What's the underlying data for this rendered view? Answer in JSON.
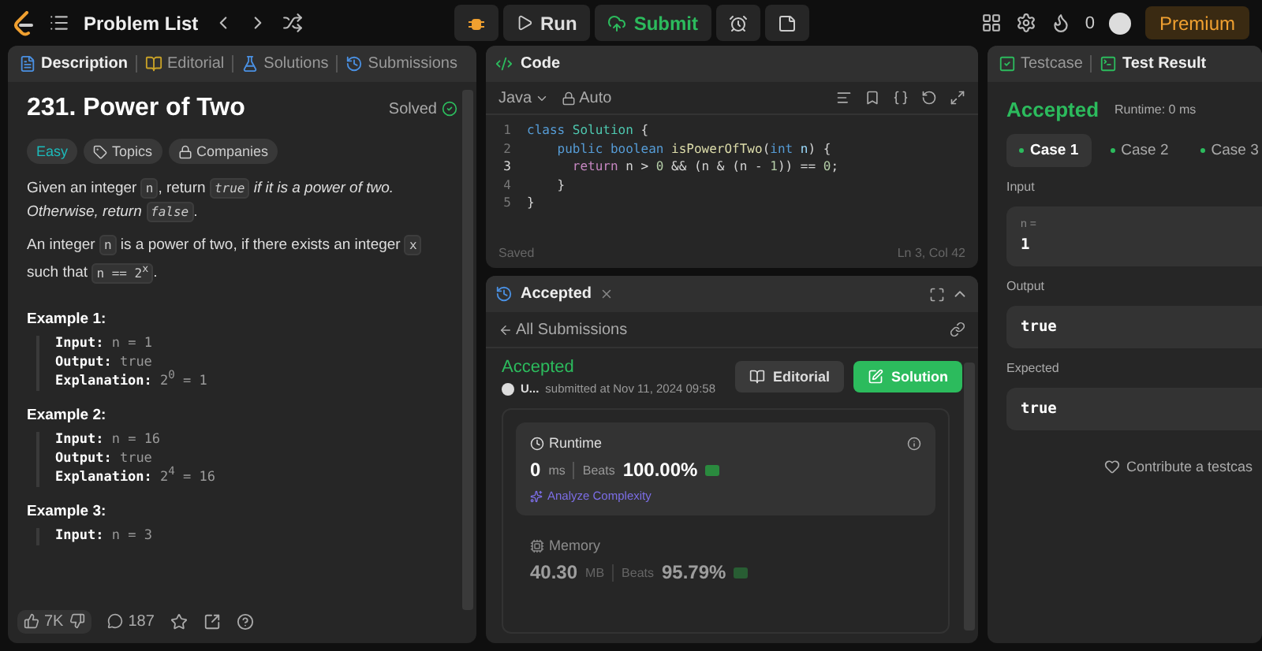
{
  "topbar": {
    "nav_title": "Problem List",
    "run": "Run",
    "submit": "Submit",
    "streak": "0",
    "premium": "Premium"
  },
  "description_panel": {
    "tabs": [
      {
        "label": "Description",
        "selected": true,
        "kind": "description"
      },
      {
        "label": "Editorial",
        "selected": false,
        "kind": "editorial"
      },
      {
        "label": "Solutions",
        "selected": false,
        "kind": "solutions"
      },
      {
        "label": "Submissions",
        "selected": false,
        "kind": "submissions"
      }
    ],
    "title": "231. Power of Two",
    "status": "Solved",
    "tags": [
      {
        "label": "Easy",
        "kind": "difficulty"
      },
      {
        "label": "Topics",
        "kind": "topics"
      },
      {
        "label": "Companies",
        "kind": "companies"
      }
    ],
    "paragraphs": [
      [
        {
          "kind": "plain",
          "text": "Given an integer "
        },
        {
          "kind": "code",
          "text": "n"
        },
        {
          "kind": "plain",
          "text": ", return "
        },
        {
          "kind": "code_italic",
          "text": "true"
        },
        {
          "kind": "italic",
          "text": " if it is a power of two. Otherwise, return "
        },
        {
          "kind": "code_italic",
          "text": "false"
        },
        {
          "kind": "plain",
          "text": "."
        }
      ],
      [
        {
          "kind": "plain",
          "text": "An integer "
        },
        {
          "kind": "code",
          "text": "n"
        },
        {
          "kind": "plain",
          "text": " is a power of two, if there exists an integer "
        },
        {
          "kind": "code",
          "text": "x"
        },
        {
          "kind": "plain",
          "text": " such that "
        },
        {
          "kind": "code",
          "text": "n == 2$^{x}$"
        },
        {
          "kind": "plain",
          "text": "."
        }
      ]
    ],
    "examples": [
      {
        "title": "Example 1:",
        "lines": [
          {
            "label": "Input:",
            "value": "n = 1"
          },
          {
            "label": "Output:",
            "value": "true"
          },
          {
            "label": "Explanation:",
            "value": "2$^{0}$ = 1"
          }
        ]
      },
      {
        "title": "Example 2:",
        "lines": [
          {
            "label": "Input:",
            "value": "n = 16"
          },
          {
            "label": "Output:",
            "value": "true"
          },
          {
            "label": "Explanation:",
            "value": "2$^{4}$ = 16"
          }
        ]
      },
      {
        "title": "Example 3:",
        "lines": [
          {
            "label": "Input:",
            "value": "n = 3"
          }
        ]
      }
    ],
    "footer": {
      "likes": "7K",
      "comments": "187"
    }
  },
  "code_panel": {
    "title": "Code",
    "language": "Java",
    "mode": "Auto",
    "status": "Saved",
    "cursor": "Ln 3, Col 42",
    "lines": [
      {
        "number": "1",
        "current": false,
        "tokens": [
          {
            "kind": "keyword",
            "text": "class "
          },
          {
            "kind": "type",
            "text": "Solution"
          },
          {
            "kind": "plain",
            "text": " {"
          }
        ]
      },
      {
        "number": "2",
        "current": false,
        "tokens": [
          {
            "kind": "keyword",
            "text": "    public boolean "
          },
          {
            "kind": "function",
            "text": "isPowerOfTwo"
          },
          {
            "kind": "plain",
            "text": "("
          },
          {
            "kind": "keyword",
            "text": "int "
          },
          {
            "kind": "variable",
            "text": "n"
          },
          {
            "kind": "plain",
            "text": ") {"
          }
        ]
      },
      {
        "number": "3",
        "current": true,
        "tokens": [
          {
            "kind": "control",
            "text": "      return "
          },
          {
            "kind": "plain",
            "text": "n > "
          },
          {
            "kind": "number",
            "text": "0"
          },
          {
            "kind": "plain",
            "text": " && (n & (n - "
          },
          {
            "kind": "number",
            "text": "1"
          },
          {
            "kind": "plain",
            "text": ")) == "
          },
          {
            "kind": "number",
            "text": "0"
          },
          {
            "kind": "plain",
            "text": ";"
          }
        ]
      },
      {
        "number": "4",
        "current": false,
        "tokens": [
          {
            "kind": "plain",
            "text": "    }"
          }
        ]
      },
      {
        "number": "5",
        "current": false,
        "tokens": [
          {
            "kind": "plain",
            "text": "}"
          }
        ]
      }
    ]
  },
  "submission_panel": {
    "tab": "Accepted",
    "back_link": "All Submissions",
    "verdict": "Accepted",
    "user": "U...",
    "submitted": "submitted at Nov 11, 2024 09:58",
    "buttons": [
      {
        "label": "Editorial",
        "kind": "secondary"
      },
      {
        "label": "Solution",
        "kind": "primary"
      }
    ],
    "stats": [
      {
        "kind": "runtime",
        "title": "Runtime",
        "value": "0",
        "unit": "ms",
        "beats_label": "Beats",
        "beats": "100.00%",
        "link": "Analyze Complexity",
        "selected": true
      },
      {
        "kind": "memory",
        "title": "Memory",
        "value": "40.30",
        "unit": "MB",
        "beats_label": "Beats",
        "beats": "95.79%",
        "selected": false
      }
    ]
  },
  "result_panel": {
    "tabs": [
      {
        "label": "Testcase",
        "selected": false,
        "kind": "testcase"
      },
      {
        "label": "Test Result",
        "selected": true,
        "kind": "result"
      }
    ],
    "verdict": "Accepted",
    "runtime": "Runtime: 0 ms",
    "cases": [
      {
        "label": "Case 1",
        "selected": true
      },
      {
        "label": "Case 2",
        "selected": false
      },
      {
        "label": "Case 3",
        "selected": false
      }
    ],
    "sections": [
      {
        "label": "Input",
        "variable": "n =",
        "value": "1"
      },
      {
        "label": "Output",
        "value": "true"
      },
      {
        "label": "Expected",
        "value": "true"
      }
    ],
    "contribute": "Contribute a testcas"
  }
}
